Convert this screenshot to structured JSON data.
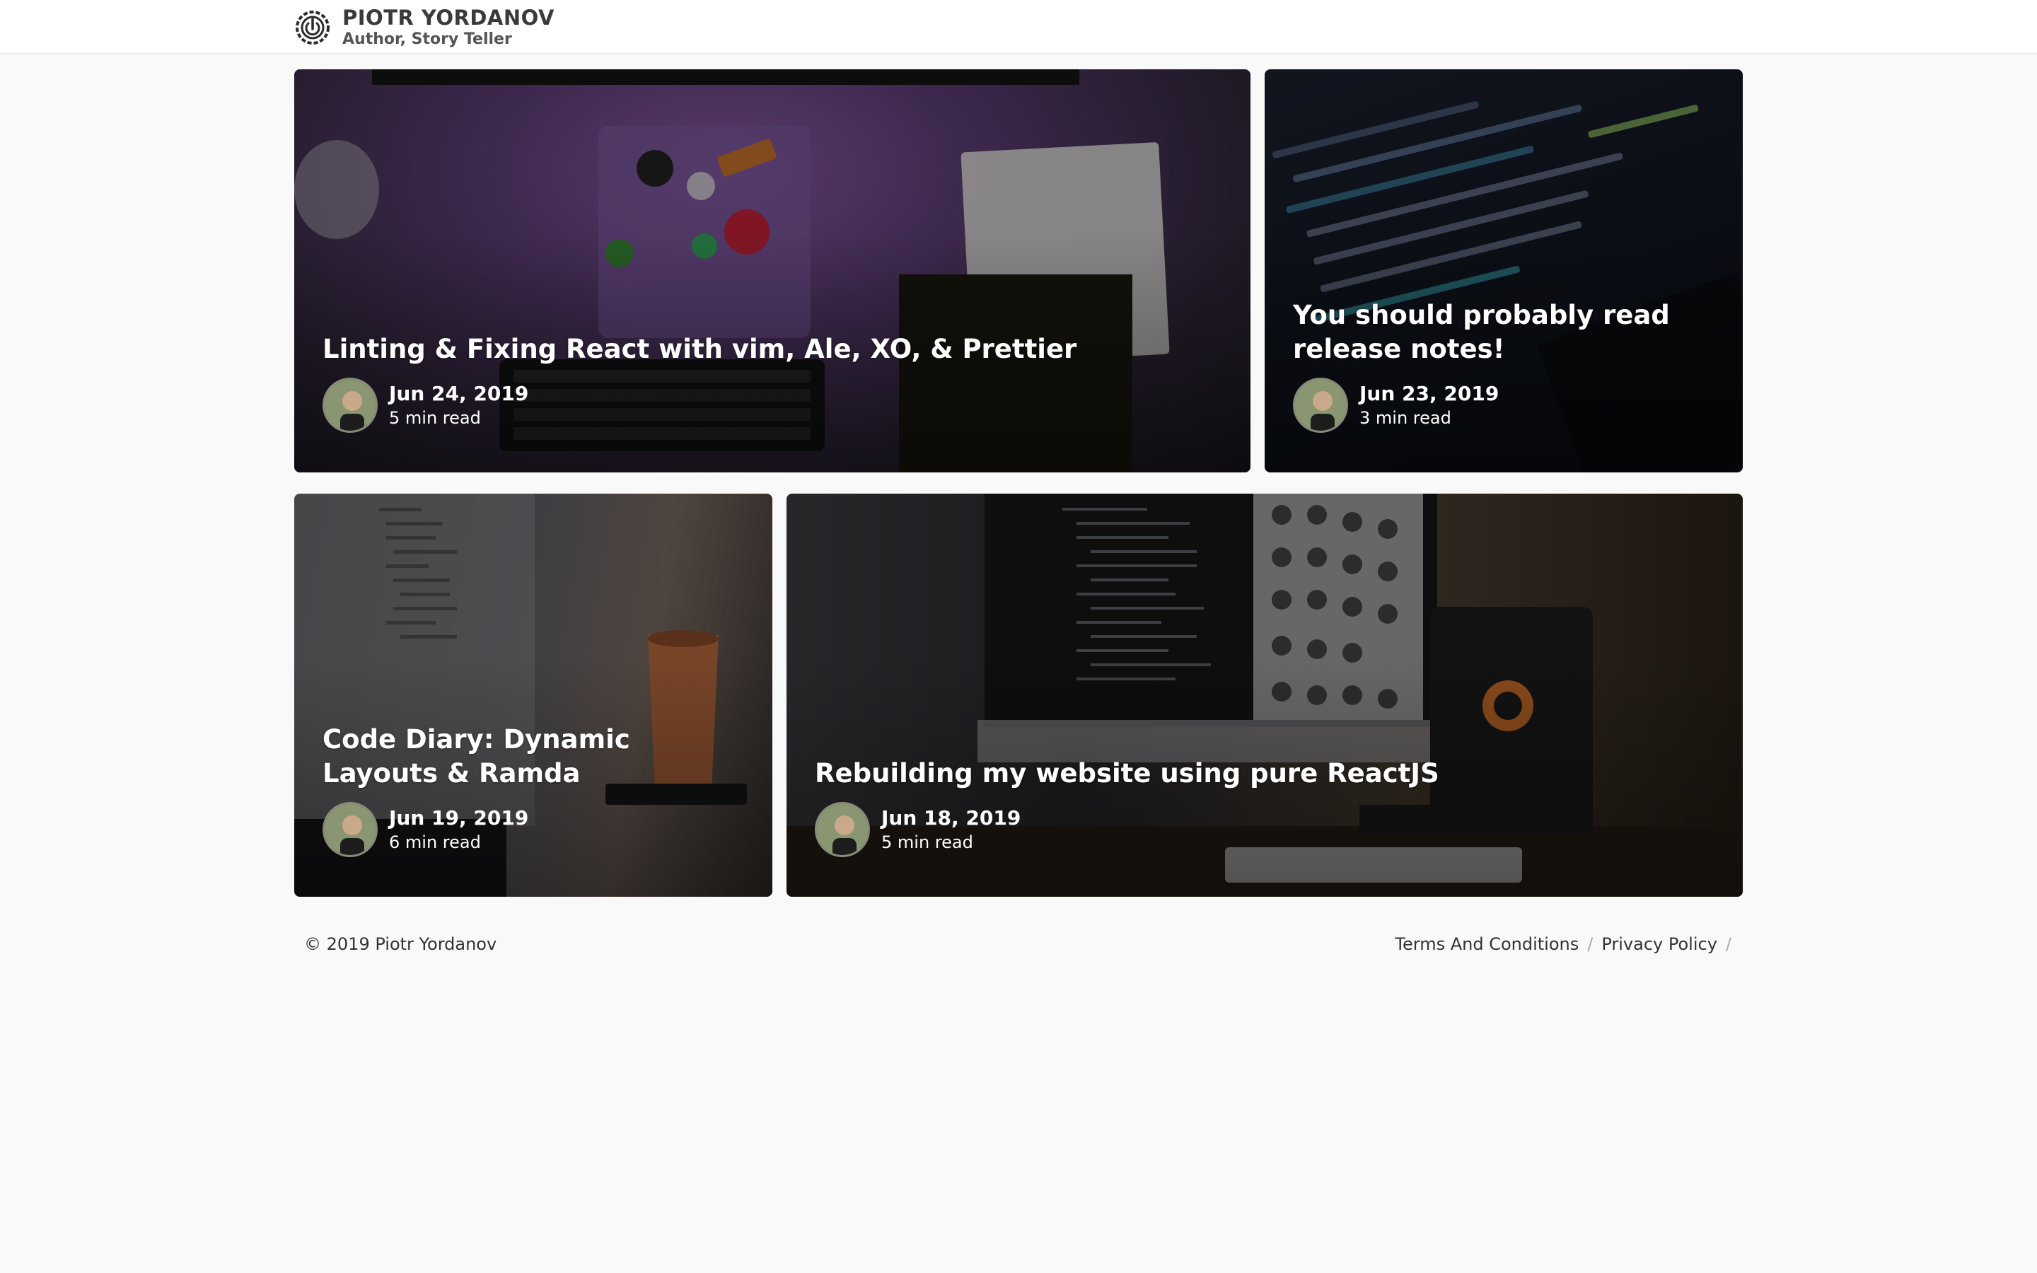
{
  "header": {
    "logo_icon": "power-sun-icon",
    "name": "PIOTR YORDANOV",
    "tagline": "Author, Story Teller"
  },
  "posts": [
    {
      "title": "Linting & Fixing React with vim, Ale, XO, & Prettier",
      "date": "Jun 24, 2019",
      "read_time": "5 min read"
    },
    {
      "title": "You should probably read release notes!",
      "date": "Jun 23, 2019",
      "read_time": "3 min read"
    },
    {
      "title": "Code Diary: Dynamic Layouts & Ramda",
      "date": "Jun 19, 2019",
      "read_time": "6 min read"
    },
    {
      "title": "Rebuilding my website using pure ReactJS",
      "date": "Jun 18, 2019",
      "read_time": "5 min read"
    }
  ],
  "footer": {
    "copyright": "© 2019 Piotr Yordanov",
    "links": [
      {
        "label": "Terms And Conditions"
      },
      {
        "label": "Privacy Policy"
      }
    ],
    "separator": "/"
  },
  "colors": {
    "background": "#f9f9f9",
    "header_bg": "#ffffff",
    "text": "#333333",
    "card_text": "#ffffff"
  }
}
